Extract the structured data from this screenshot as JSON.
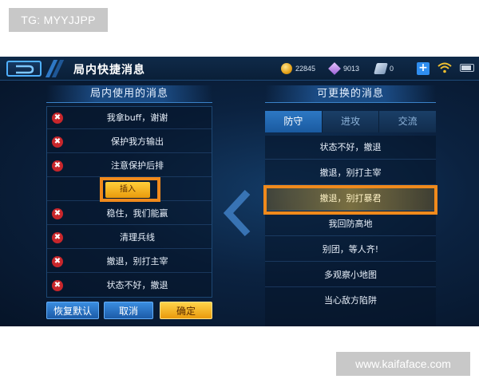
{
  "watermarks": {
    "tg": "TG: MYYJJPP",
    "site": "www.kaifaface.com"
  },
  "header": {
    "title": "局内快捷消息",
    "currencies": [
      {
        "icon": "coin-icon",
        "value": "22845"
      },
      {
        "icon": "diamond-icon",
        "value": "9013"
      },
      {
        "icon": "ticket-icon",
        "value": "0"
      }
    ],
    "plus_label": "+"
  },
  "left_panel": {
    "title": "局内使用的消息",
    "messages": [
      {
        "text": "我拿buff，谢谢",
        "type": "message"
      },
      {
        "text": "保护我方输出",
        "type": "message"
      },
      {
        "text": "注意保护后排",
        "type": "message"
      },
      {
        "text": "插入",
        "type": "insert"
      },
      {
        "text": "稳住，我们能赢",
        "type": "message"
      },
      {
        "text": "清理兵线",
        "type": "message"
      },
      {
        "text": "撤退，别打主宰",
        "type": "message"
      },
      {
        "text": "状态不好，撤退",
        "type": "message"
      }
    ],
    "delete_glyph": "✖"
  },
  "buttons": {
    "reset": "恢复默认",
    "cancel": "取消",
    "confirm": "确定"
  },
  "right_panel": {
    "title": "可更换的消息",
    "tabs": [
      "防守",
      "进攻",
      "交流"
    ],
    "active_tab": "防守",
    "options": [
      {
        "text": "状态不好，撤退",
        "selected": false
      },
      {
        "text": "撤退，别打主宰",
        "selected": false
      },
      {
        "text": "撤退，别打暴君",
        "selected": true
      },
      {
        "text": "我回防高地",
        "selected": false
      },
      {
        "text": "别团，等人齐!",
        "selected": false
      },
      {
        "text": "多观察小地图",
        "selected": false
      },
      {
        "text": "当心敌方陷阱",
        "selected": false
      }
    ]
  },
  "colors": {
    "highlight": "#f08a1c",
    "accent_blue": "#2d78c4",
    "gold": "#ffcf3a",
    "delete_red": "#c8262b"
  }
}
